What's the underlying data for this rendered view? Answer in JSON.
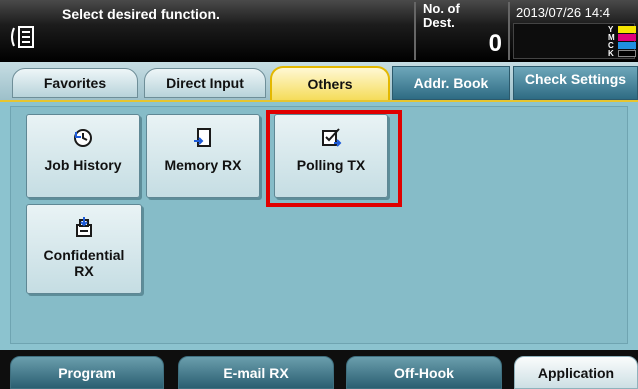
{
  "header": {
    "message": "Select desired function.",
    "dest_label": "No. of\nDest.",
    "dest_count": "0",
    "datetime": "2013/07/26 14:4",
    "toner_letters": [
      "Y",
      "M",
      "C",
      "K"
    ],
    "toner_colors": [
      "#f5e400",
      "#e0007a",
      "#1f8fe0",
      "#000000"
    ]
  },
  "tabs": {
    "favorites": "Favorites",
    "direct_input": "Direct Input",
    "others": "Others",
    "addr_book": "Addr. Book",
    "check_settings": "Check Settings",
    "active": "Others"
  },
  "functions": [
    {
      "label": "Job History",
      "icon": "job-history-icon"
    },
    {
      "label": "Memory RX",
      "icon": "memory-rx-icon"
    },
    {
      "label": "Polling TX",
      "icon": "polling-tx-icon",
      "highlighted": true
    },
    {
      "label": "Confidential\nRX",
      "icon": "confidential-rx-icon"
    }
  ],
  "bottom": {
    "program": "Program",
    "email_rx": "E-mail RX",
    "off_hook": "Off-Hook",
    "application": "Application"
  },
  "colors": {
    "highlight": "#e00000",
    "active_tab": "#f5dc5a",
    "content_bg": "#8cc3cf"
  }
}
